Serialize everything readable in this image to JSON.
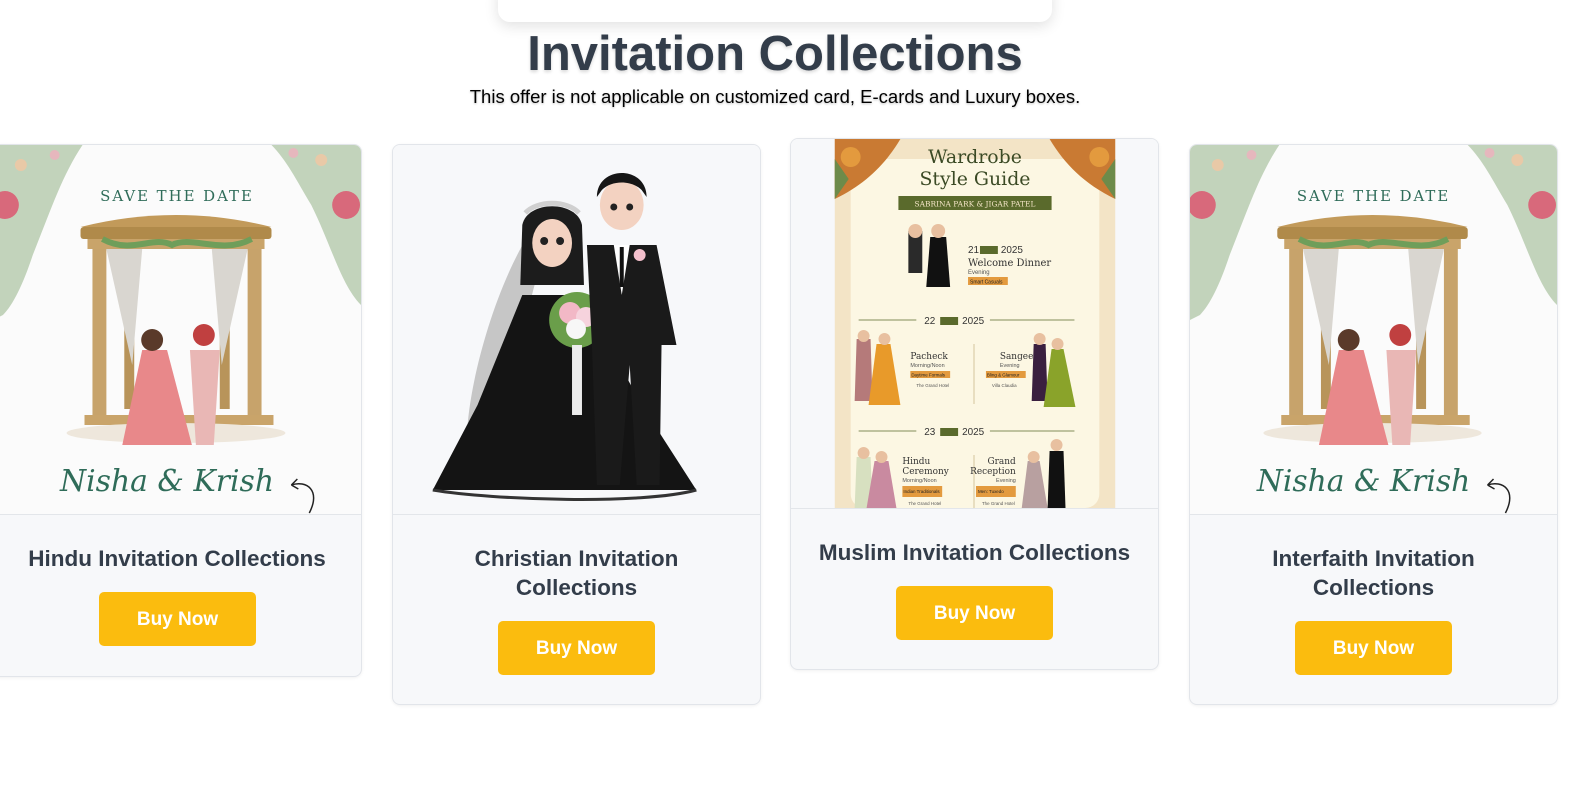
{
  "section": {
    "title": "Invitation Collections",
    "subtitle": "This offer is not applicable on customized card, E-cards and Luxury boxes."
  },
  "cards": [
    {
      "title": "Hindu Invitation Collections",
      "button": "Buy Now",
      "image_text": {
        "save_the_date": "SAVE THE DATE",
        "names": "Nisha & Krish"
      }
    },
    {
      "title": "Christian Invitation Collections",
      "button": "Buy Now"
    },
    {
      "title": "Muslim Invitation Collections",
      "button": "Buy Now",
      "image_text": {
        "heading_line1": "Wardrobe",
        "heading_line2": "Style Guide",
        "couple": "SABRINA PARK & JIGAR PATEL",
        "day1_date": "21",
        "day1_year": "2025",
        "day1_event": "Welcome Dinner",
        "day1_time": "Evening",
        "day1_dress": "Smart Casuals",
        "day2_date": "22",
        "day2_year": "2025",
        "day2_event_a": "Pacheck",
        "day2_time_a": "Morning/Noon",
        "day2_dress_a": "Daytime Formals",
        "day2_venue_a": "The Grand Hotel",
        "day2_event_b": "Sangeet",
        "day2_time_b": "Evening",
        "day2_dress_b": "Bling & Glamour",
        "day2_venue_b": "Villa Claudia",
        "day3_date": "23",
        "day3_year": "2025",
        "day3_event_a1": "Hindu",
        "day3_event_a2": "Ceremony",
        "day3_time_a": "Morning/Noon",
        "day3_dress_a": "Indian Traditionals",
        "day3_venue_a": "The Grand Hotel",
        "day3_event_b1": "Grand",
        "day3_event_b2": "Reception",
        "day3_time_b": "Evening",
        "day3_dress_b": "Men: Tuxedo",
        "day3_venue_b": "The Grand Hotel"
      }
    },
    {
      "title": "Interfaith Invitation Collections",
      "button": "Buy Now",
      "image_text": {
        "save_the_date": "SAVE THE DATE",
        "names": "Nisha & Krish"
      }
    }
  ],
  "colors": {
    "button": "#fbbc0e",
    "heading": "#333d4a",
    "card_bg": "#f7f8fa"
  }
}
